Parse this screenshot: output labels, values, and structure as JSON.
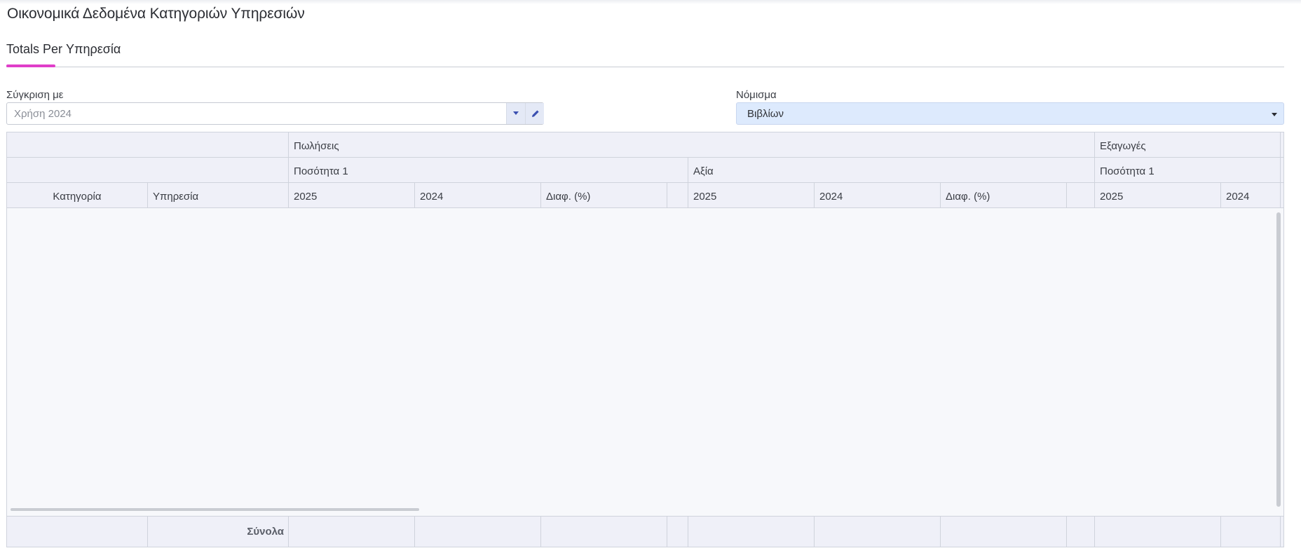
{
  "page": {
    "title": "Οικονομικά Δεδομένα Κατηγοριών Υπηρεσιών"
  },
  "tabs": [
    {
      "label": "Totals Per Υπηρεσία",
      "active": true
    }
  ],
  "colors": {
    "tab_indicator": "#e03ec9",
    "header_bg": "#eff0f8",
    "currency_field_bg": "#ddeafd",
    "combo_button_bg": "#e4e9f6"
  },
  "filters": {
    "compare": {
      "label": "Σύγκριση με",
      "value": "Χρήση 2024",
      "icons": [
        "dropdown-arrow-icon",
        "pencil-icon"
      ]
    },
    "currency": {
      "label": "Νόμισμα",
      "value": "Βιβλίων",
      "icons": [
        "dropdown-arrow-icon"
      ]
    }
  },
  "grid": {
    "group_row": {
      "sales": "Πωλήσεις",
      "exports": "Εξαγωγές"
    },
    "subgroup_row": {
      "sales_quantity": "Ποσότητα 1",
      "sales_value": "Αξία",
      "exports_quantity": "Ποσότητα 1"
    },
    "columns": {
      "category": "Κατηγορία",
      "service": "Υπηρεσία",
      "sq_2025": "2025",
      "sq_2024": "2024",
      "sq_diff": "Διαφ. (%)",
      "sv_2025": "2025",
      "sv_2024": "2024",
      "sv_diff": "Διαφ. (%)",
      "eq_2025": "2025",
      "eq_2024": "2024"
    },
    "rows": [],
    "footer": {
      "totals_label": "Σύνολα"
    }
  }
}
